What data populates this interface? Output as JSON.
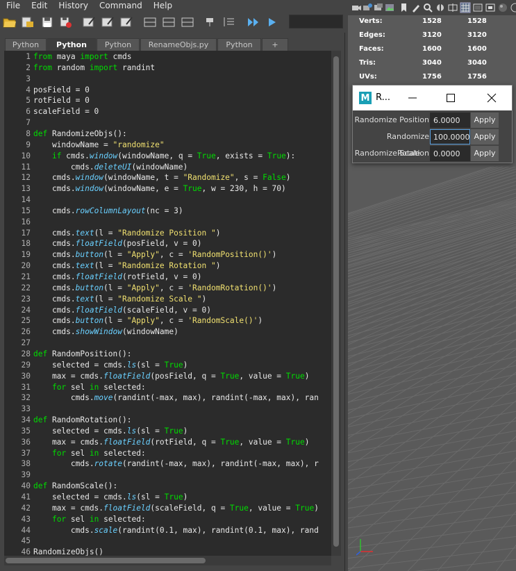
{
  "menubar": {
    "items": [
      "File",
      "Edit",
      "History",
      "Command",
      "Help"
    ]
  },
  "tabs": [
    {
      "label": "Python"
    },
    {
      "label": "Python"
    },
    {
      "label": "Python"
    },
    {
      "label": "RenameObjs.py"
    },
    {
      "label": "Python"
    },
    {
      "label": "+"
    }
  ],
  "code": {
    "lines": [
      [
        [
          "kw",
          "from"
        ],
        [
          "op",
          " maya "
        ],
        [
          "kw",
          "import"
        ],
        [
          "op",
          " cmds"
        ]
      ],
      [
        [
          "kw",
          "from"
        ],
        [
          "op",
          " random "
        ],
        [
          "kw",
          "import"
        ],
        [
          "op",
          " randint"
        ]
      ],
      [],
      [
        [
          "op",
          "posField = 0"
        ]
      ],
      [
        [
          "op",
          "rotField = 0"
        ]
      ],
      [
        [
          "op",
          "scaleField = 0"
        ]
      ],
      [],
      [
        [
          "kw",
          "def"
        ],
        [
          "op",
          " RandomizeObjs():"
        ]
      ],
      [
        [
          "op",
          "    windowName = "
        ],
        [
          "str",
          "\"randomize\""
        ]
      ],
      [
        [
          "op",
          "    "
        ],
        [
          "kw",
          "if"
        ],
        [
          "op",
          " cmds."
        ],
        [
          "fn",
          "window"
        ],
        [
          "op",
          "(windowName, q = "
        ],
        [
          "kw",
          "True"
        ],
        [
          "op",
          ", exists = "
        ],
        [
          "kw",
          "True"
        ],
        [
          "op",
          "):"
        ]
      ],
      [
        [
          "op",
          "        cmds."
        ],
        [
          "fn",
          "deleteUI"
        ],
        [
          "op",
          "(windowName)"
        ]
      ],
      [
        [
          "op",
          "    cmds."
        ],
        [
          "fn",
          "window"
        ],
        [
          "op",
          "(windowName, t = "
        ],
        [
          "str",
          "\"Randomize\""
        ],
        [
          "op",
          ", s = "
        ],
        [
          "kw",
          "False"
        ],
        [
          "op",
          ")"
        ]
      ],
      [
        [
          "op",
          "    cmds."
        ],
        [
          "fn",
          "window"
        ],
        [
          "op",
          "(windowName, e = "
        ],
        [
          "kw",
          "True"
        ],
        [
          "op",
          ", w = 230, h = 70)"
        ]
      ],
      [],
      [
        [
          "op",
          "    cmds."
        ],
        [
          "fn",
          "rowColumnLayout"
        ],
        [
          "op",
          "(nc = 3)"
        ]
      ],
      [],
      [
        [
          "op",
          "    cmds."
        ],
        [
          "fn",
          "text"
        ],
        [
          "op",
          "(l = "
        ],
        [
          "str",
          "\"Randomize Position \""
        ],
        [
          "op",
          ")"
        ]
      ],
      [
        [
          "op",
          "    cmds."
        ],
        [
          "fn",
          "floatField"
        ],
        [
          "op",
          "(posField, v = 0)"
        ]
      ],
      [
        [
          "op",
          "    cmds."
        ],
        [
          "fn",
          "button"
        ],
        [
          "op",
          "(l = "
        ],
        [
          "str",
          "\"Apply\""
        ],
        [
          "op",
          ", c = "
        ],
        [
          "str",
          "'RandomPosition()'"
        ],
        [
          "op",
          ")"
        ]
      ],
      [
        [
          "op",
          "    cmds."
        ],
        [
          "fn",
          "text"
        ],
        [
          "op",
          "(l = "
        ],
        [
          "str",
          "\"Randomize Rotation \""
        ],
        [
          "op",
          ")"
        ]
      ],
      [
        [
          "op",
          "    cmds."
        ],
        [
          "fn",
          "floatField"
        ],
        [
          "op",
          "(rotField, v = 0)"
        ]
      ],
      [
        [
          "op",
          "    cmds."
        ],
        [
          "fn",
          "button"
        ],
        [
          "op",
          "(l = "
        ],
        [
          "str",
          "\"Apply\""
        ],
        [
          "op",
          ", c = "
        ],
        [
          "str",
          "'RandomRotation()'"
        ],
        [
          "op",
          ")"
        ]
      ],
      [
        [
          "op",
          "    cmds."
        ],
        [
          "fn",
          "text"
        ],
        [
          "op",
          "(l = "
        ],
        [
          "str",
          "\"Randomize Scale \""
        ],
        [
          "op",
          ")"
        ]
      ],
      [
        [
          "op",
          "    cmds."
        ],
        [
          "fn",
          "floatField"
        ],
        [
          "op",
          "(scaleField, v = 0)"
        ]
      ],
      [
        [
          "op",
          "    cmds."
        ],
        [
          "fn",
          "button"
        ],
        [
          "op",
          "(l = "
        ],
        [
          "str",
          "\"Apply\""
        ],
        [
          "op",
          ", c = "
        ],
        [
          "str",
          "'RandomScale()'"
        ],
        [
          "op",
          ")"
        ]
      ],
      [
        [
          "op",
          "    cmds."
        ],
        [
          "fn",
          "showWindow"
        ],
        [
          "op",
          "(windowName)"
        ]
      ],
      [],
      [
        [
          "kw",
          "def"
        ],
        [
          "op",
          " RandomPosition():"
        ]
      ],
      [
        [
          "op",
          "    selected = cmds."
        ],
        [
          "fn",
          "ls"
        ],
        [
          "op",
          "(sl = "
        ],
        [
          "kw",
          "True"
        ],
        [
          "op",
          ")"
        ]
      ],
      [
        [
          "op",
          "    max = cmds."
        ],
        [
          "fn",
          "floatField"
        ],
        [
          "op",
          "(posField, q = "
        ],
        [
          "kw",
          "True"
        ],
        [
          "op",
          ", value = "
        ],
        [
          "kw",
          "True"
        ],
        [
          "op",
          ")"
        ]
      ],
      [
        [
          "op",
          "    "
        ],
        [
          "kw",
          "for"
        ],
        [
          "op",
          " sel "
        ],
        [
          "kw",
          "in"
        ],
        [
          "op",
          " selected:"
        ]
      ],
      [
        [
          "op",
          "        cmds."
        ],
        [
          "fn",
          "move"
        ],
        [
          "op",
          "(randint(-max, max), randint(-max, max), ran"
        ]
      ],
      [],
      [
        [
          "kw",
          "def"
        ],
        [
          "op",
          " RandomRotation():"
        ]
      ],
      [
        [
          "op",
          "    selected = cmds."
        ],
        [
          "fn",
          "ls"
        ],
        [
          "op",
          "(sl = "
        ],
        [
          "kw",
          "True"
        ],
        [
          "op",
          ")"
        ]
      ],
      [
        [
          "op",
          "    max = cmds."
        ],
        [
          "fn",
          "floatField"
        ],
        [
          "op",
          "(rotField, q = "
        ],
        [
          "kw",
          "True"
        ],
        [
          "op",
          ", value = "
        ],
        [
          "kw",
          "True"
        ],
        [
          "op",
          ")"
        ]
      ],
      [
        [
          "op",
          "    "
        ],
        [
          "kw",
          "for"
        ],
        [
          "op",
          " sel "
        ],
        [
          "kw",
          "in"
        ],
        [
          "op",
          " selected:"
        ]
      ],
      [
        [
          "op",
          "        cmds."
        ],
        [
          "fn",
          "rotate"
        ],
        [
          "op",
          "(randint(-max, max), randint(-max, max), r"
        ]
      ],
      [],
      [
        [
          "kw",
          "def"
        ],
        [
          "op",
          " RandomScale():"
        ]
      ],
      [
        [
          "op",
          "    selected = cmds."
        ],
        [
          "fn",
          "ls"
        ],
        [
          "op",
          "(sl = "
        ],
        [
          "kw",
          "True"
        ],
        [
          "op",
          ")"
        ]
      ],
      [
        [
          "op",
          "    max = cmds."
        ],
        [
          "fn",
          "floatField"
        ],
        [
          "op",
          "(scaleField, q = "
        ],
        [
          "kw",
          "True"
        ],
        [
          "op",
          ", value = "
        ],
        [
          "kw",
          "True"
        ],
        [
          "op",
          ")"
        ]
      ],
      [
        [
          "op",
          "    "
        ],
        [
          "kw",
          "for"
        ],
        [
          "op",
          " sel "
        ],
        [
          "kw",
          "in"
        ],
        [
          "op",
          " selected:"
        ]
      ],
      [
        [
          "op",
          "        cmds."
        ],
        [
          "fn",
          "scale"
        ],
        [
          "op",
          "(randint(0.1, max), randint(0.1, max), rand"
        ]
      ],
      [],
      [
        [
          "op",
          "RandomizeObjs()"
        ]
      ]
    ]
  },
  "hud": {
    "rows": [
      {
        "label": "Verts:",
        "a": "1528",
        "b": "1528"
      },
      {
        "label": "Edges:",
        "a": "3120",
        "b": "3120"
      },
      {
        "label": "Faces:",
        "a": "1600",
        "b": "1600"
      },
      {
        "label": "Tris:",
        "a": "3040",
        "b": "3040"
      },
      {
        "label": "UVs:",
        "a": "1756",
        "b": "1756"
      }
    ]
  },
  "window": {
    "title": "R...",
    "logo": "M",
    "rows": [
      {
        "label": "Randomize Position",
        "value": "6.0000",
        "button": "Apply"
      },
      {
        "label": "Randomize Rotation",
        "value": "100.0000",
        "button": "Apply"
      },
      {
        "label": "Randomize Scale",
        "value": "0.0000",
        "button": "Apply"
      }
    ]
  },
  "colors": {
    "keyword": "#00dd00",
    "string": "#f0e070",
    "function": "#6ad0ff",
    "panel": "#444444",
    "code_bg": "#2b2b2b"
  }
}
